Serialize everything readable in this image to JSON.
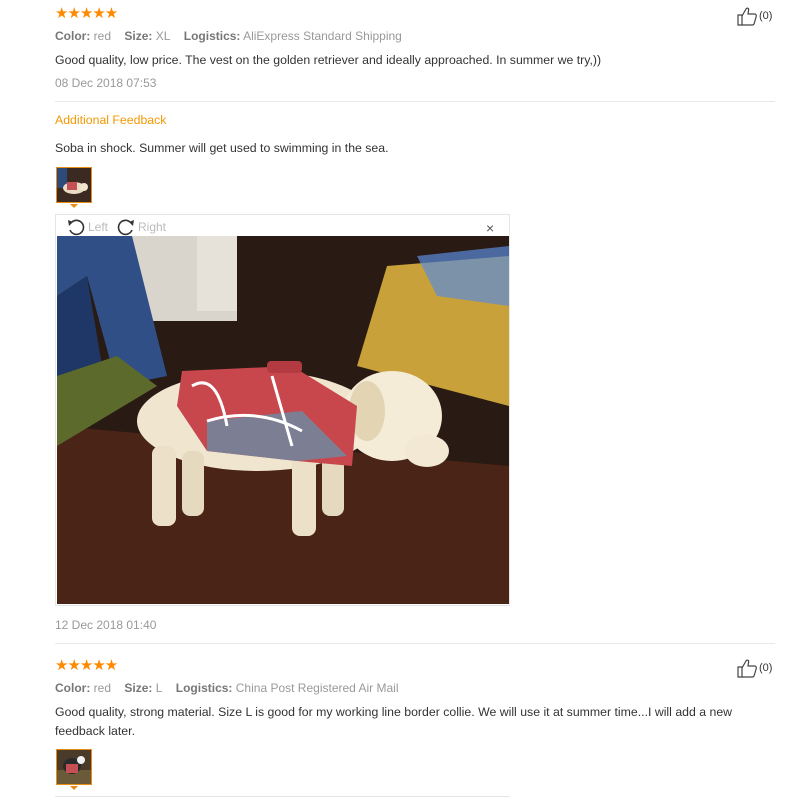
{
  "review1": {
    "stars": "★★★★★",
    "color_label": "Color:",
    "color_value": "red",
    "size_label": "Size:",
    "size_value": "XL",
    "logistics_label": "Logistics:",
    "logistics_value": "AliExpress Standard Shipping",
    "text": "Good quality, low price. The vest on the golden retriever and ideally approached. In summer we try,))",
    "date": "08 Dec 2018 07:53",
    "helpful_count": "(0)",
    "additional_feedback": {
      "heading": "Additional Feedback",
      "text": "Soba in shock. Summer will get used to swimming in the sea.",
      "date": "12 Dec 2018 01:40",
      "viewer": {
        "rotate_left": "Left",
        "rotate_right": "Right",
        "close": "×"
      }
    }
  },
  "review2": {
    "stars": "★★★★★",
    "color_label": "Color:",
    "color_value": "red",
    "size_label": "Size:",
    "size_value": "L",
    "logistics_label": "Logistics:",
    "logistics_value": "China Post Registered Air Mail",
    "text": "Good quality, strong material. Size L is good for my working line border collie. We will use it at summer time...I will add a new feedback later.",
    "helpful_count": "(0)"
  },
  "colors": {
    "star": "#ff8a00",
    "accent_orange": "#f39801",
    "meta_grey": "#999999",
    "divider": "#e8e8e8"
  },
  "icons": [
    "thumbs-up-icon",
    "rotate-left-icon",
    "rotate-right-icon",
    "close-icon"
  ]
}
